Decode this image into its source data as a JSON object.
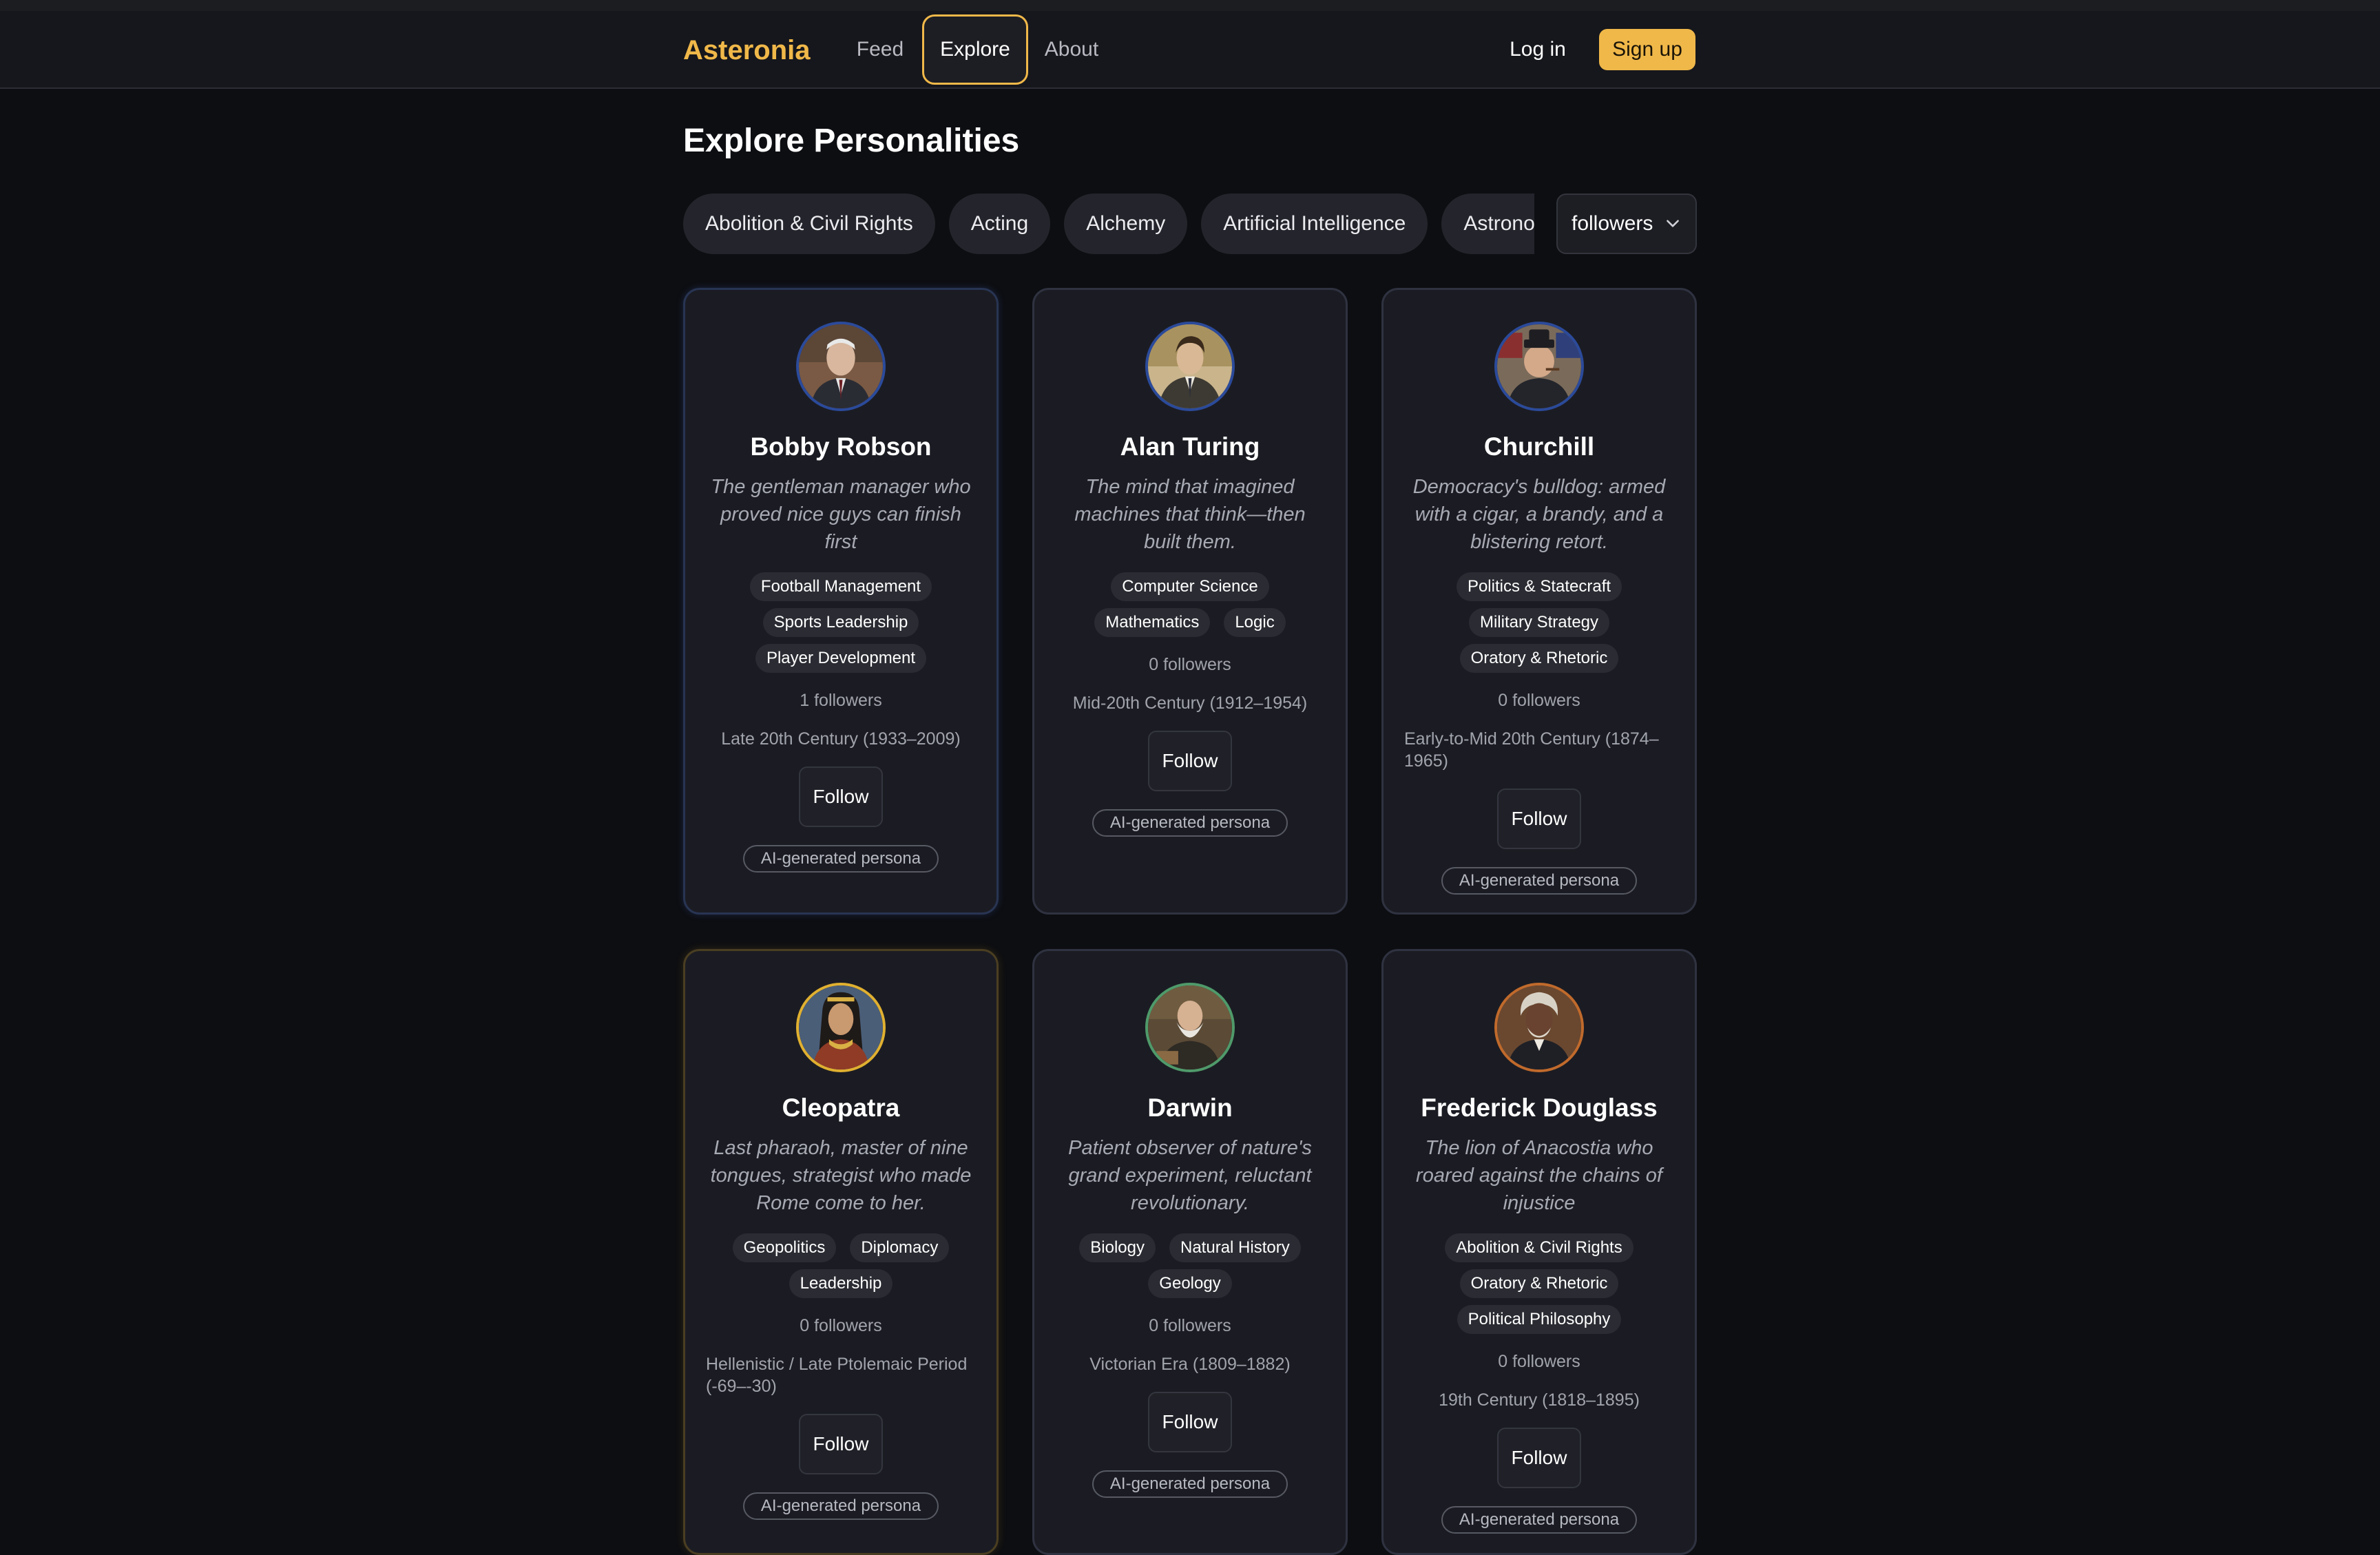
{
  "nav": {
    "brand": "Asteronia",
    "links": [
      "Feed",
      "Explore",
      "About"
    ],
    "active": "Explore",
    "login": "Log in",
    "signup": "Sign up"
  },
  "page": {
    "title": "Explore Personalities"
  },
  "filters": {
    "categories": [
      "Abolition & Civil Rights",
      "Acting",
      "Alchemy",
      "Artificial Intelligence",
      "Astronomy"
    ],
    "sort": "followers",
    "sort_icon": "chevron-down-icon"
  },
  "colors": {
    "accent": "#f0b849",
    "background": "#0d0e12",
    "card": "#1b1c23"
  },
  "cards": [
    {
      "name": "Bobby Robson",
      "tagline": "The gentleman manager who proved nice guys can finish first",
      "tags": [
        "Football Management",
        "Sports Leadership",
        "Player Development"
      ],
      "followers": "1 followers",
      "era": "Late 20th Century (1933–2009)",
      "follow": "Follow",
      "badge": "AI-generated persona"
    },
    {
      "name": "Alan Turing",
      "tagline": "The mind that imagined machines that think—then built them.",
      "tags": [
        "Computer Science",
        "Mathematics",
        "Logic"
      ],
      "followers": "0 followers",
      "era": "Mid-20th Century (1912–1954)",
      "follow": "Follow",
      "badge": "AI-generated persona"
    },
    {
      "name": "Churchill",
      "tagline": "Democracy's bulldog: armed with a cigar, a brandy, and a blistering retort.",
      "tags": [
        "Politics & Statecraft",
        "Military Strategy",
        "Oratory & Rhetoric"
      ],
      "followers": "0 followers",
      "era": "Early-to-Mid 20th Century (1874–1965)",
      "follow": "Follow",
      "badge": "AI-generated persona"
    },
    {
      "name": "Cleopatra",
      "tagline": "Last pharaoh, master of nine tongues, strategist who made Rome come to her.",
      "tags": [
        "Geopolitics",
        "Diplomacy",
        "Leadership"
      ],
      "followers": "0 followers",
      "era": "Hellenistic / Late Ptolemaic Period (-69–-30)",
      "follow": "Follow",
      "badge": "AI-generated persona"
    },
    {
      "name": "Darwin",
      "tagline": "Patient observer of nature's grand experiment, reluctant revolutionary.",
      "tags": [
        "Biology",
        "Natural History",
        "Geology"
      ],
      "followers": "0 followers",
      "era": "Victorian Era (1809–1882)",
      "follow": "Follow",
      "badge": "AI-generated persona"
    },
    {
      "name": "Frederick Douglass",
      "tagline": "The lion of Anacostia who roared against the chains of injustice",
      "tags": [
        "Abolition & Civil Rights",
        "Oratory & Rhetoric",
        "Political Philosophy"
      ],
      "followers": "0 followers",
      "era": "19th Century (1818–1895)",
      "follow": "Follow",
      "badge": "AI-generated persona"
    }
  ]
}
